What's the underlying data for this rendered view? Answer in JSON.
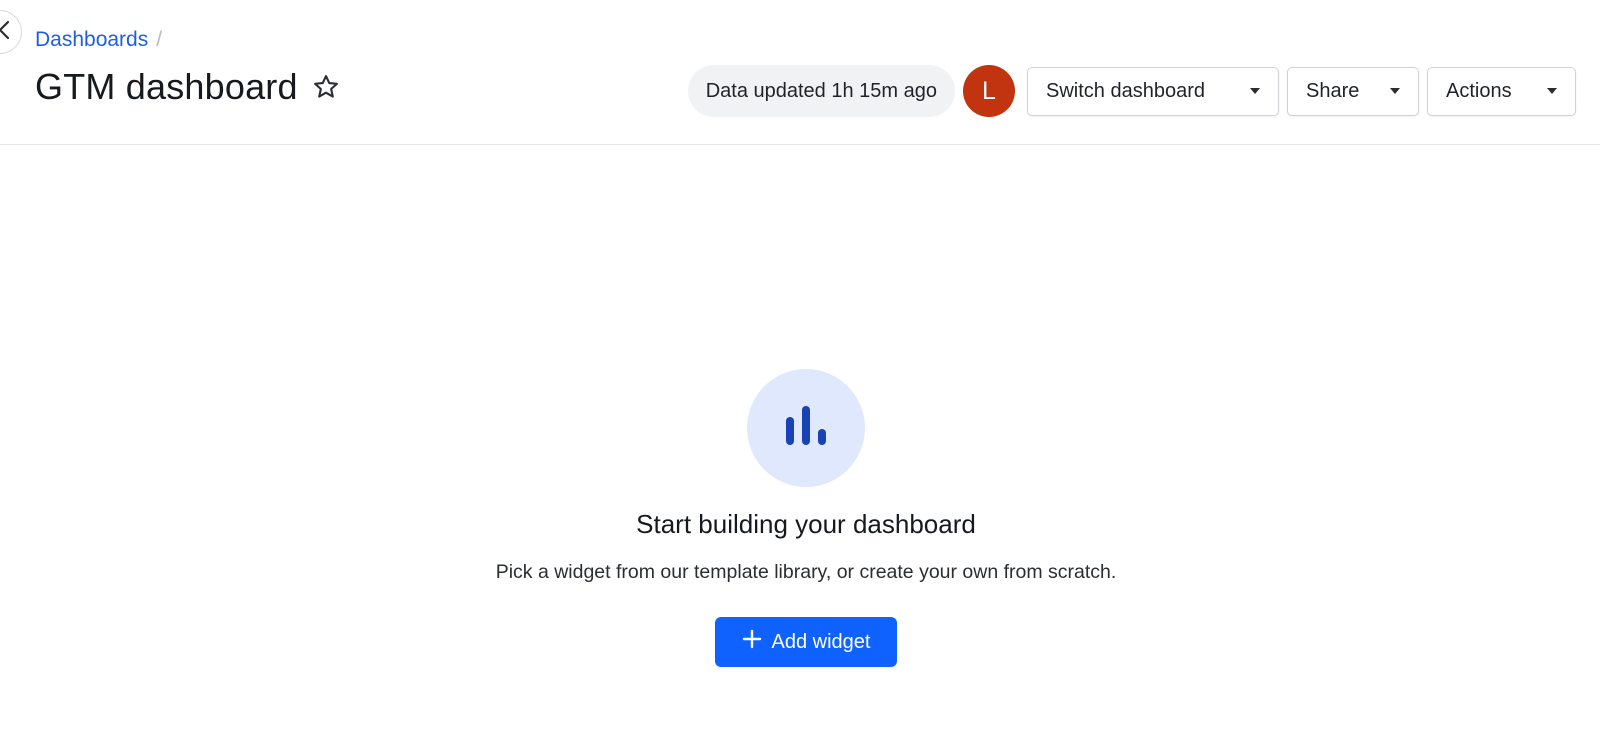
{
  "breadcrumb": {
    "link": "Dashboards",
    "separator": "/"
  },
  "page": {
    "title": "GTM dashboard"
  },
  "toolbar": {
    "data_updated": "Data updated 1h 15m ago",
    "avatar_initial": "L",
    "switch_dashboard": "Switch dashboard",
    "share": "Share",
    "actions": "Actions"
  },
  "empty_state": {
    "icon": "bar-chart-icon",
    "title": "Start building your dashboard",
    "description": "Pick a widget from our template library, or create your own from scratch.",
    "button": "Add widget"
  },
  "colors": {
    "accent": "#0f62fe",
    "link": "#1f5fe0",
    "avatar": "#c2340f",
    "icon_bg": "#dfe8fc",
    "icon_fg": "#1843b4"
  }
}
